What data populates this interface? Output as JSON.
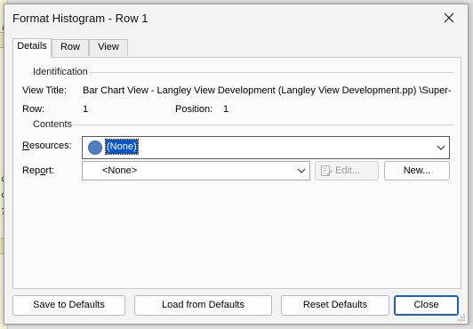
{
  "window": {
    "title": "Format Histogram - Row 1"
  },
  "background": {
    "row_glyphs": [
      "r",
      "c",
      "c",
      "T"
    ]
  },
  "tabs": [
    {
      "label": "Details",
      "active": true
    },
    {
      "label": "Row",
      "active": false
    },
    {
      "label": "View",
      "active": false
    }
  ],
  "identification": {
    "section_label": "Identification",
    "view_title_label": "View Title:",
    "view_title_value": "Bar Chart View - Langley View Development (Langley View Development.pp) \\Super-Str",
    "row_label": "Row:",
    "row_value": "1",
    "position_label": "Position:",
    "position_value": "1"
  },
  "contents": {
    "section_label": "Contents",
    "resources_label": "Resources:",
    "resources_value": "(None)",
    "resources_color": "#4f7fbf",
    "report_label": "Report:",
    "report_value": "<None>",
    "edit_button": "Edit...",
    "new_button": "New..."
  },
  "footer": {
    "save_defaults": "Save to Defaults",
    "load_defaults": "Load from Defaults",
    "reset_defaults": "Reset Defaults",
    "close": "Close"
  },
  "colors": {
    "selection": "#0a55c8",
    "primary_border": "#1c5fb4"
  }
}
